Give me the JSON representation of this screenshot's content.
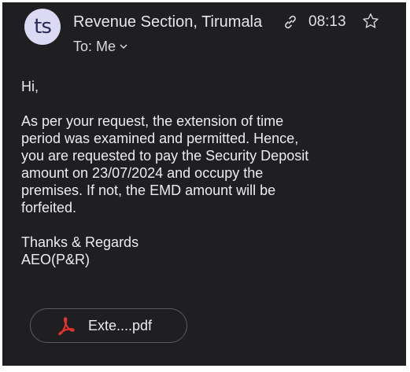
{
  "header": {
    "avatar_initials": "ts",
    "sender_name": "Revenue Section, Tirumala",
    "recipient_line": "To: Me",
    "time": "08:13"
  },
  "icons": {
    "link": "link-icon",
    "star": "star-outline-icon",
    "recipients_toggle": "chevron-down-icon",
    "attachment": "pdf-icon"
  },
  "message": {
    "greeting": "Hi,",
    "body_lines": [
      "As per your request, the extension of time",
      "period was examined and permitted. Hence,",
      "you are requested to pay the Security Deposit",
      "amount on 23/07/2024 and occupy the",
      "premises. If not,  the EMD amount will be",
      "forfeited."
    ],
    "closing": "Thanks & Regards",
    "signature": "AEO(P&R)"
  },
  "attachment": {
    "name": "Exte....pdf"
  },
  "colors": {
    "background": "#1f1f21",
    "avatar_bg": "#dcd9f4",
    "avatar_text": "#2b2a55",
    "pdf_red": "#e2342d",
    "text": "#e8e8ea"
  }
}
